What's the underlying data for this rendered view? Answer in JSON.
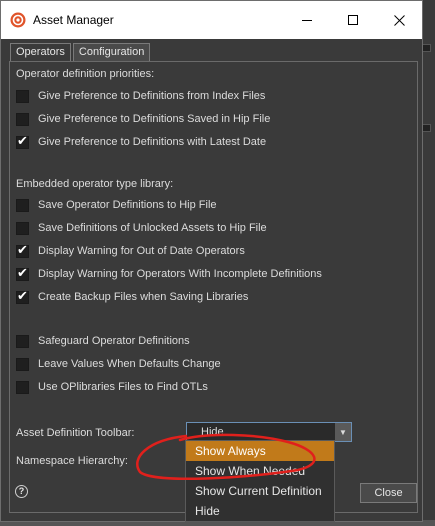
{
  "window": {
    "title": "Asset Manager",
    "accent_color": "#e0542a"
  },
  "tabs": [
    {
      "label": "Operators",
      "active": false
    },
    {
      "label": "Configuration",
      "active": true
    }
  ],
  "priorities": {
    "heading": "Operator definition priorities:",
    "options": [
      {
        "label": "Give Preference to Definitions from Index Files",
        "checked": false
      },
      {
        "label": "Give Preference to Definitions Saved in Hip File",
        "checked": false
      },
      {
        "label": "Give Preference to Definitions with Latest Date",
        "checked": true
      }
    ]
  },
  "embedded": {
    "heading": "Embedded operator type library:",
    "options": [
      {
        "label": "Save Operator Definitions to Hip File",
        "checked": false
      },
      {
        "label": "Save Definitions of Unlocked Assets to Hip File",
        "checked": false
      },
      {
        "label": "Display Warning for Out of Date Operators",
        "checked": true
      },
      {
        "label": "Display Warning for Operators With Incomplete Definitions",
        "checked": true
      },
      {
        "label": "Create Backup Files when Saving Libraries",
        "checked": true
      }
    ]
  },
  "misc": {
    "options": [
      {
        "label": "Safeguard Operator Definitions",
        "checked": false
      },
      {
        "label": "Leave Values When Defaults Change",
        "checked": false
      },
      {
        "label": "Use OPlibraries Files to Find OTLs",
        "checked": false
      }
    ]
  },
  "asset_toolbar": {
    "label": "Asset Definition Toolbar:",
    "value": "Hide"
  },
  "namespace": {
    "label": "Namespace Hierarchy:"
  },
  "dropdown_menu": {
    "items": [
      "Show Always",
      "Show When Needed",
      "Show Current Definition",
      "Hide"
    ],
    "highlighted": 0,
    "highlight_color": "#c17a1a"
  },
  "footer": {
    "help_glyph": "?",
    "close_label": "Close"
  },
  "annotation": {
    "color": "#e0201c"
  }
}
